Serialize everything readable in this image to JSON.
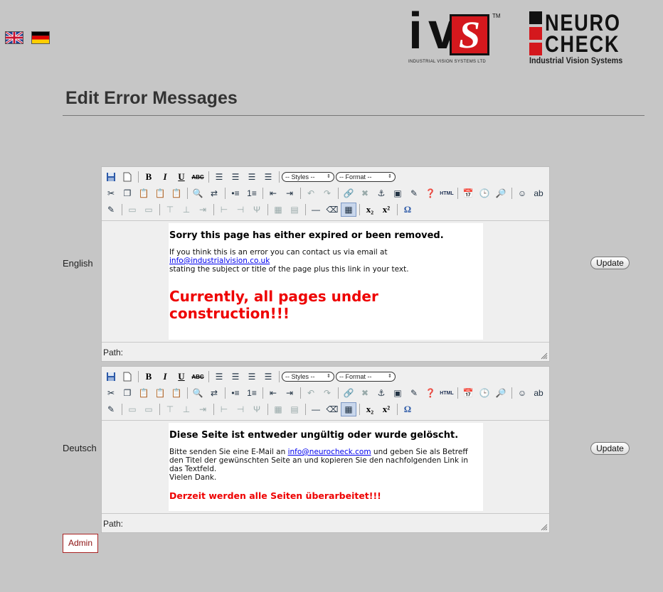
{
  "languages": [
    {
      "code": "en",
      "name": "English flag"
    },
    {
      "code": "de",
      "name": "German flag"
    }
  ],
  "logos": {
    "ivs": {
      "letters_i": "i",
      "letters_v": "v",
      "letters_s": "S",
      "tm": "TM",
      "tagline": "INDUSTRIAL VISION SYSTEMS LTD"
    },
    "neurocheck": {
      "word_top": "NEURO",
      "word_bottom": "CHECK",
      "tagline": "Industrial Vision Systems"
    }
  },
  "page_title": "Edit Error Messages",
  "toolbar": {
    "styles_label": "-- Styles --",
    "format_label": "-- Format --",
    "html_label": "HTML"
  },
  "editors": [
    {
      "label": "English",
      "update_label": "Update",
      "heading": "Sorry this page has either expired or been removed.",
      "body_before_link": "If you think this is an error you can contact us via email at ",
      "link": "info@industrialvision.co.uk",
      "body_after_link": "stating the subject or title of the page plus this link in your text.",
      "highlight": "Currently, all pages under construction!!!",
      "path_label": "Path:"
    },
    {
      "label": "Deutsch",
      "update_label": "Update",
      "heading": "Diese Seite ist entweder ungültig oder wurde gelöscht.",
      "body_before_link": "Bitte senden Sie eine E-Mail an ",
      "link": "info@neurocheck.com",
      "body_after_link": " und geben Sie als Betreff den Titel der gewünschten Seite an und kopieren Sie den nachfolgenden Link in das Textfeld.",
      "closing": "Vielen Dank.",
      "highlight": "Derzeit werden alle Seiten überarbeitet!!!",
      "path_label": "Path:"
    }
  ],
  "admin_label": "Admin",
  "colors": {
    "background": "#c6c6c6",
    "alert_red": "#e00000",
    "link_blue": "#0000ee",
    "brand_red": "#d4181d"
  }
}
